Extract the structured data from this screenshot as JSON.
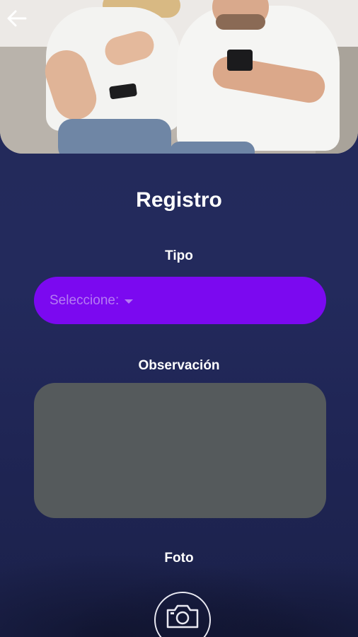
{
  "header": {
    "back_icon": "arrow-left-icon",
    "photo": "couple-on-sofa-with-phones"
  },
  "form": {
    "title": "Registro",
    "tipo": {
      "label": "Tipo",
      "placeholder": "Seleccione:",
      "caret_icon": "caret-down-icon"
    },
    "observacion": {
      "label": "Observación",
      "value": ""
    },
    "foto": {
      "label": "Foto",
      "camera_icon": "camera-icon"
    }
  },
  "colors": {
    "background": "#232a5a",
    "select_bg": "#7b09f0",
    "select_text": "#b57cf2",
    "textarea_bg": "#555a5c",
    "text": "#ffffff"
  }
}
